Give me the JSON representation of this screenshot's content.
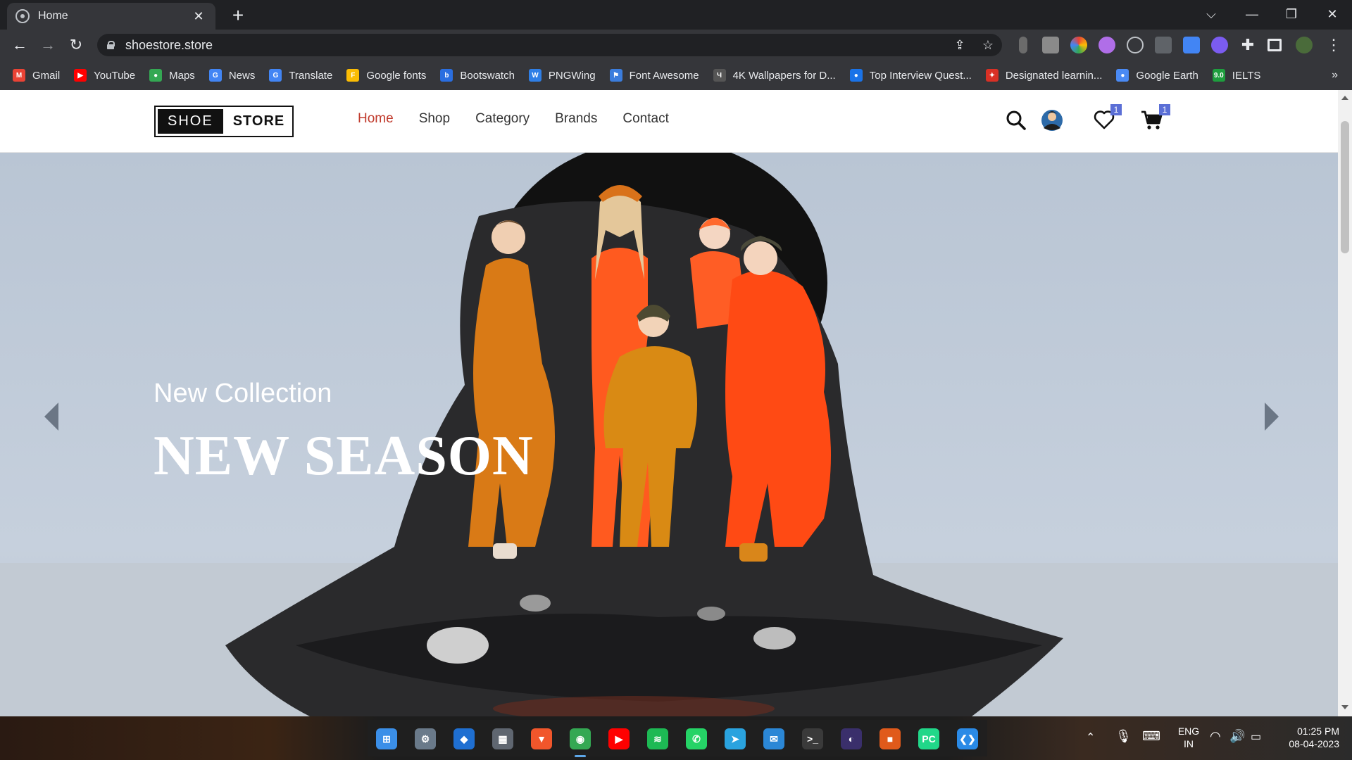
{
  "browser": {
    "tab_title": "Home",
    "tab_close": "✕",
    "new_tab": "+",
    "window_controls": {
      "tabsearch": "⌵",
      "minimize": "—",
      "restore": "❐",
      "close": "✕"
    },
    "url": "shoestore.store",
    "bookmarks": [
      {
        "label": "Gmail",
        "icon": "gmail-icon",
        "color": "#ea4335",
        "glyph": "M"
      },
      {
        "label": "YouTube",
        "icon": "youtube-icon",
        "color": "#ff0000",
        "glyph": "▶"
      },
      {
        "label": "Maps",
        "icon": "maps-icon",
        "color": "#34a853",
        "glyph": "●"
      },
      {
        "label": "News",
        "icon": "news-icon",
        "color": "#4285f4",
        "glyph": "G"
      },
      {
        "label": "Translate",
        "icon": "translate-icon",
        "color": "#4285f4",
        "glyph": "G"
      },
      {
        "label": "Google fonts",
        "icon": "google-fonts-icon",
        "color": "#fbbc04",
        "glyph": "F"
      },
      {
        "label": "Bootswatch",
        "icon": "bootswatch-icon",
        "color": "#2a6ee0",
        "glyph": "b"
      },
      {
        "label": "PNGWing",
        "icon": "pngwing-icon",
        "color": "#2f7fe6",
        "glyph": "W"
      },
      {
        "label": "Font Awesome",
        "icon": "font-awesome-icon",
        "color": "#3b7ddd",
        "glyph": "⚑"
      },
      {
        "label": "4K Wallpapers for D...",
        "icon": "wallpapers-icon",
        "color": "#555555",
        "glyph": "Ч"
      },
      {
        "label": "Top Interview Quest...",
        "icon": "interview-icon",
        "color": "#1a73e8",
        "glyph": "●"
      },
      {
        "label": "Designated learnin...",
        "icon": "maple-leaf-icon",
        "color": "#d93025",
        "glyph": "✦"
      },
      {
        "label": "Google Earth",
        "icon": "google-earth-icon",
        "color": "#4a8af4",
        "glyph": "●"
      },
      {
        "label": "IELTS",
        "icon": "ielts-icon",
        "color": "#1e9e3e",
        "glyph": "9.0"
      }
    ],
    "bookmarks_more": "»"
  },
  "site": {
    "logo_left": "SHOE",
    "logo_right": "STORE",
    "menu": [
      "Home",
      "Shop",
      "Category",
      "Brands",
      "Contact"
    ],
    "active_menu": "Home",
    "wishlist_count": "1",
    "cart_count": "1"
  },
  "hero": {
    "subtitle": "New Collection",
    "title": "NEW SEASON"
  },
  "taskbar": {
    "apps": [
      {
        "name": "start-icon",
        "color": "#3b8fe8",
        "glyph": "⊞"
      },
      {
        "name": "settings-icon",
        "color": "#6a7a8a",
        "glyph": "⚙"
      },
      {
        "name": "security-icon",
        "color": "#1f6fd1",
        "glyph": "◆"
      },
      {
        "name": "calculator-icon",
        "color": "#5f6670",
        "glyph": "▦"
      },
      {
        "name": "brave-icon",
        "color": "#f1562b",
        "glyph": "▼"
      },
      {
        "name": "chrome-icon",
        "color": "#34a853",
        "glyph": "◉"
      },
      {
        "name": "youtube-icon",
        "color": "#ff0000",
        "glyph": "▶"
      },
      {
        "name": "spotify-icon",
        "color": "#1db954",
        "glyph": "≋"
      },
      {
        "name": "whatsapp-icon",
        "color": "#25d366",
        "glyph": "✆"
      },
      {
        "name": "telegram-icon",
        "color": "#2aa3df",
        "glyph": "➤"
      },
      {
        "name": "mail-icon",
        "color": "#2b87d6",
        "glyph": "✉"
      },
      {
        "name": "terminal-icon",
        "color": "#3a3a3a",
        "glyph": ">_"
      },
      {
        "name": "eclipse-icon",
        "color": "#3a2f6b",
        "glyph": "◐"
      },
      {
        "name": "office-icon",
        "color": "#e05a1b",
        "glyph": "■"
      },
      {
        "name": "pycharm-icon",
        "color": "#21d789",
        "glyph": "PC"
      },
      {
        "name": "vscode-icon",
        "color": "#2a8ae6",
        "glyph": "❮❯"
      }
    ],
    "active_app": "chrome-icon",
    "tray": {
      "lang_top": "ENG",
      "lang_bottom": "IN",
      "time": "01:25 PM",
      "date": "08-04-2023"
    }
  }
}
